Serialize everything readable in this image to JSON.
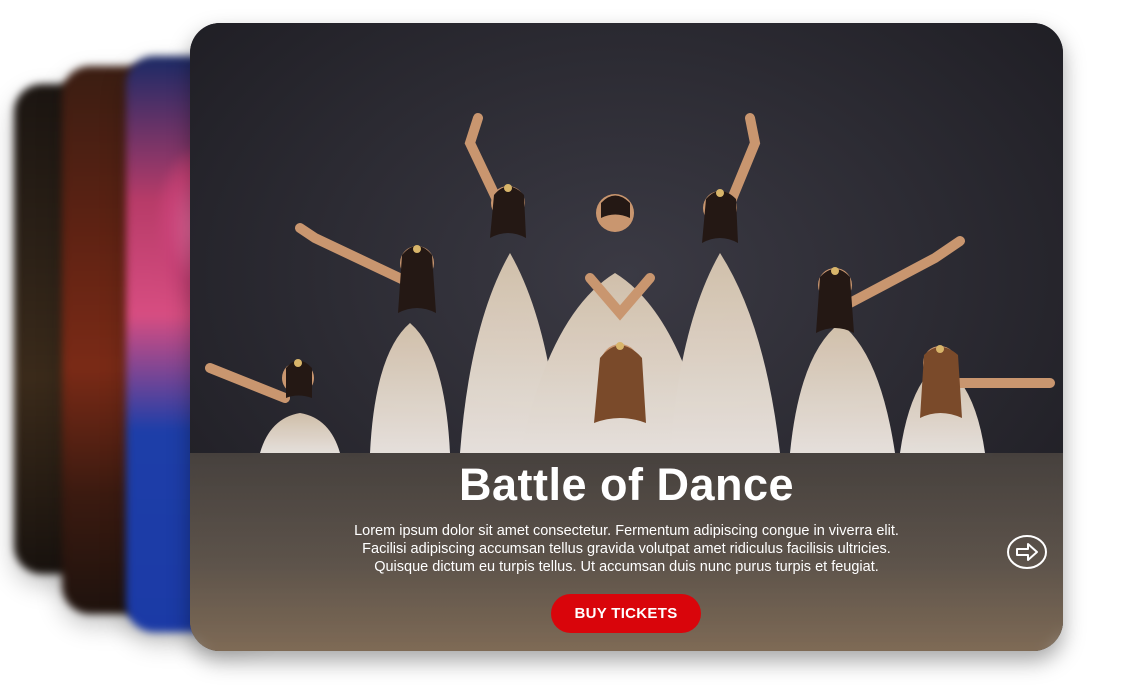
{
  "event": {
    "title": "Battle of Dance",
    "description_lines": [
      "Lorem ipsum dolor sit amet consectetur. Fermentum adipiscing congue in viverra elit.",
      "Facilisi adipiscing accumsan tellus gravida volutpat amet ridiculus facilisis ultricies.",
      "Quisque dictum eu turpis tellus. Ut accumsan duis nunc purus turpis et feugiat."
    ],
    "cta_label": "BUY TICKETS",
    "next_icon": "arrow-right-circle-icon"
  },
  "colors": {
    "cta": "#d9050b",
    "text": "#ffffff",
    "backdrop": "#2a2830"
  }
}
